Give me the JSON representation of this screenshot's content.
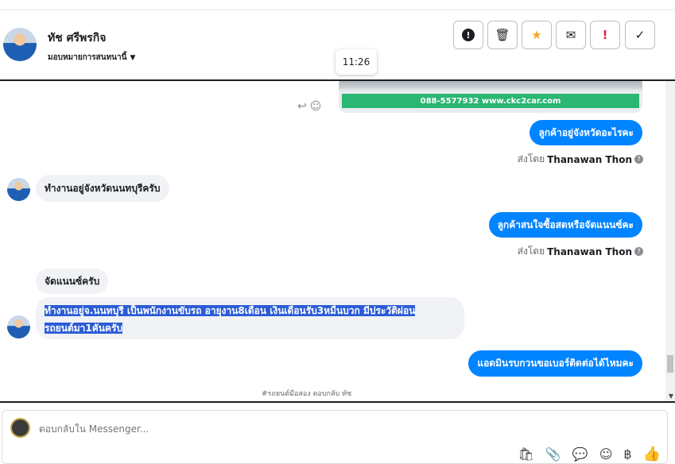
{
  "header": {
    "name": "ทัช ศรีพรกิจ",
    "subtitle": "มอบหมายการสนทนานี้",
    "caret": "▼",
    "tool_icons": [
      "!",
      "🗑",
      "★",
      "✉",
      "!",
      "✓"
    ]
  },
  "tooltip": {
    "time": "11:26"
  },
  "chat": {
    "image_banner": "088-5577932 www.ckc2car.com",
    "reply_icons": [
      "↩",
      "☺"
    ],
    "messages": [
      {
        "text": "ลูกค้าอยู่จังหวัดอะไรคะ"
      },
      {
        "text": "ทำงานอยู่จังหวัดนนทบุรีครับ"
      },
      {
        "text": "ลูกค้าสนใจซื้อสดหรือจัดแนนซ์คะ"
      },
      {
        "text": "จัดแนนซ์ครับ"
      },
      {
        "text_line1": "ทำงานอยู่จ.นนทบุรี เป็นพนักงานขับรถ อายุงาน8เดือน เงินเดือนรับ3หมื่นบวก มีประวัติผ่อน",
        "text_line2": "รถยนต์มา1คันครับ"
      },
      {
        "text": "แอดมินรบกวนขอเบอร์ติดต่อได้ไหมคะ"
      }
    ],
    "sent_by_prefix": "ส่งโดย",
    "sent_by_name": "Thanawan Thon",
    "help_glyph": "?",
    "footer_note": "#รถยนต์มือสอง ตอบกลับ ทัช"
  },
  "composer": {
    "placeholder": "ตอบกลับใน Messenger...",
    "tools": [
      "🛍",
      "📎",
      "💬",
      "☺",
      "฿",
      "👍"
    ]
  }
}
